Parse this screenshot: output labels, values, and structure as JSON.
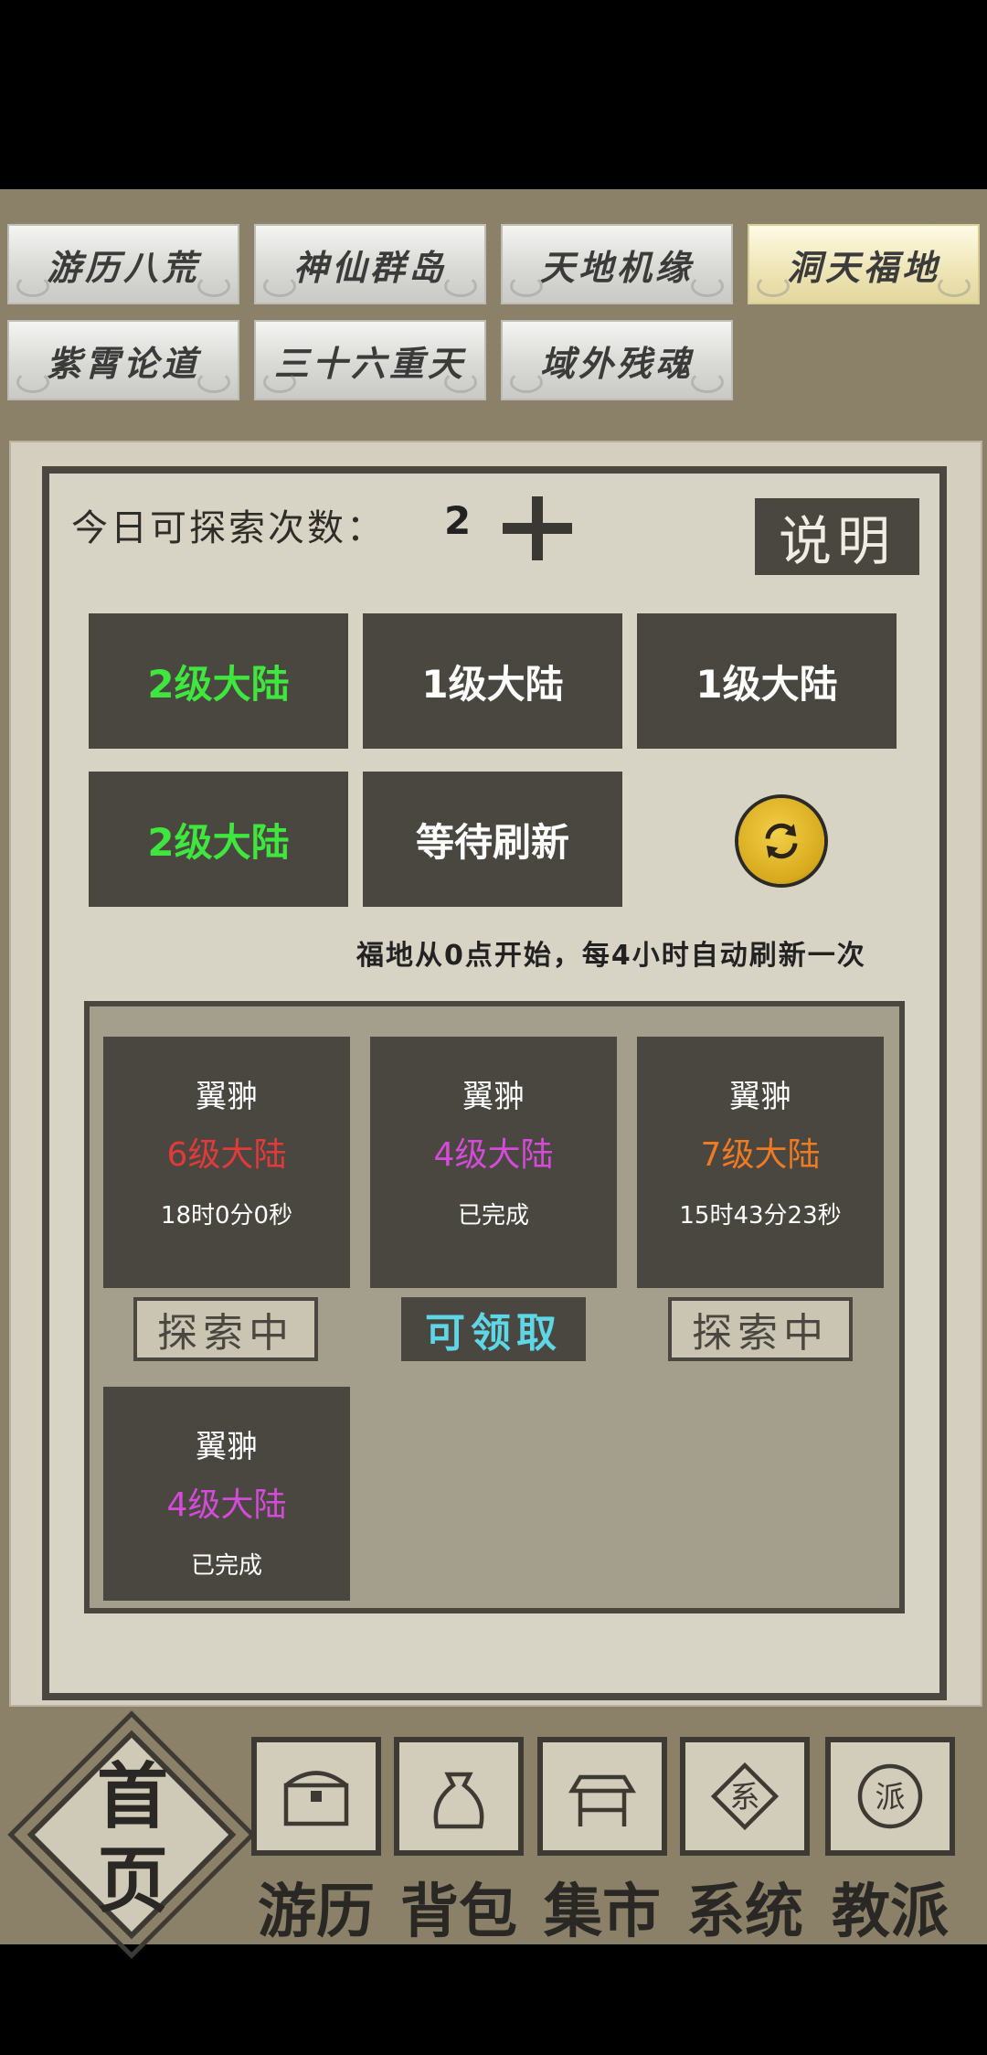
{
  "tabs": [
    {
      "label": "游历八荒",
      "active": false
    },
    {
      "label": "神仙群岛",
      "active": false
    },
    {
      "label": "天地机缘",
      "active": false
    },
    {
      "label": "洞天福地",
      "active": true
    },
    {
      "label": "紫霄论道",
      "active": false
    },
    {
      "label": "三十六重天",
      "active": false
    },
    {
      "label": "域外残魂",
      "active": false
    }
  ],
  "header": {
    "count_label": "今日可探索次数：",
    "count_value": "2",
    "help_label": "说明"
  },
  "lands": [
    {
      "label": "2级大陆",
      "color": "#3ee63e"
    },
    {
      "label": "1级大陆",
      "color": "#ffffff"
    },
    {
      "label": "1级大陆",
      "color": "#ffffff"
    },
    {
      "label": "2级大陆",
      "color": "#3ee63e"
    },
    {
      "label": "等待刷新",
      "color": "#ffffff"
    }
  ],
  "refresh_icon": "refresh-icon",
  "note": "福地从0点开始，每4小时自动刷新一次",
  "expeditions": [
    {
      "name": "翼翀",
      "level": "6级大陆",
      "level_color": "#e23a3a",
      "time": "18时0分0秒",
      "status": "探索中"
    },
    {
      "name": "翼翀",
      "level": "4级大陆",
      "level_color": "#d34bd8",
      "time": "已完成",
      "status": "可领取"
    },
    {
      "name": "翼翀",
      "level": "7级大陆",
      "level_color": "#f07a22",
      "time": "15时43分23秒",
      "status": "探索中"
    },
    {
      "name": "翼翀",
      "level": "4级大陆",
      "level_color": "#d34bd8",
      "time": "已完成",
      "status": ""
    }
  ],
  "nav": {
    "home": "首页",
    "items": [
      {
        "label": "游历",
        "icon": "chest-icon"
      },
      {
        "label": "背包",
        "icon": "bag-icon"
      },
      {
        "label": "集市",
        "icon": "stall-icon"
      },
      {
        "label": "系统",
        "icon": "system-icon"
      },
      {
        "label": "教派",
        "icon": "sect-icon"
      }
    ]
  }
}
